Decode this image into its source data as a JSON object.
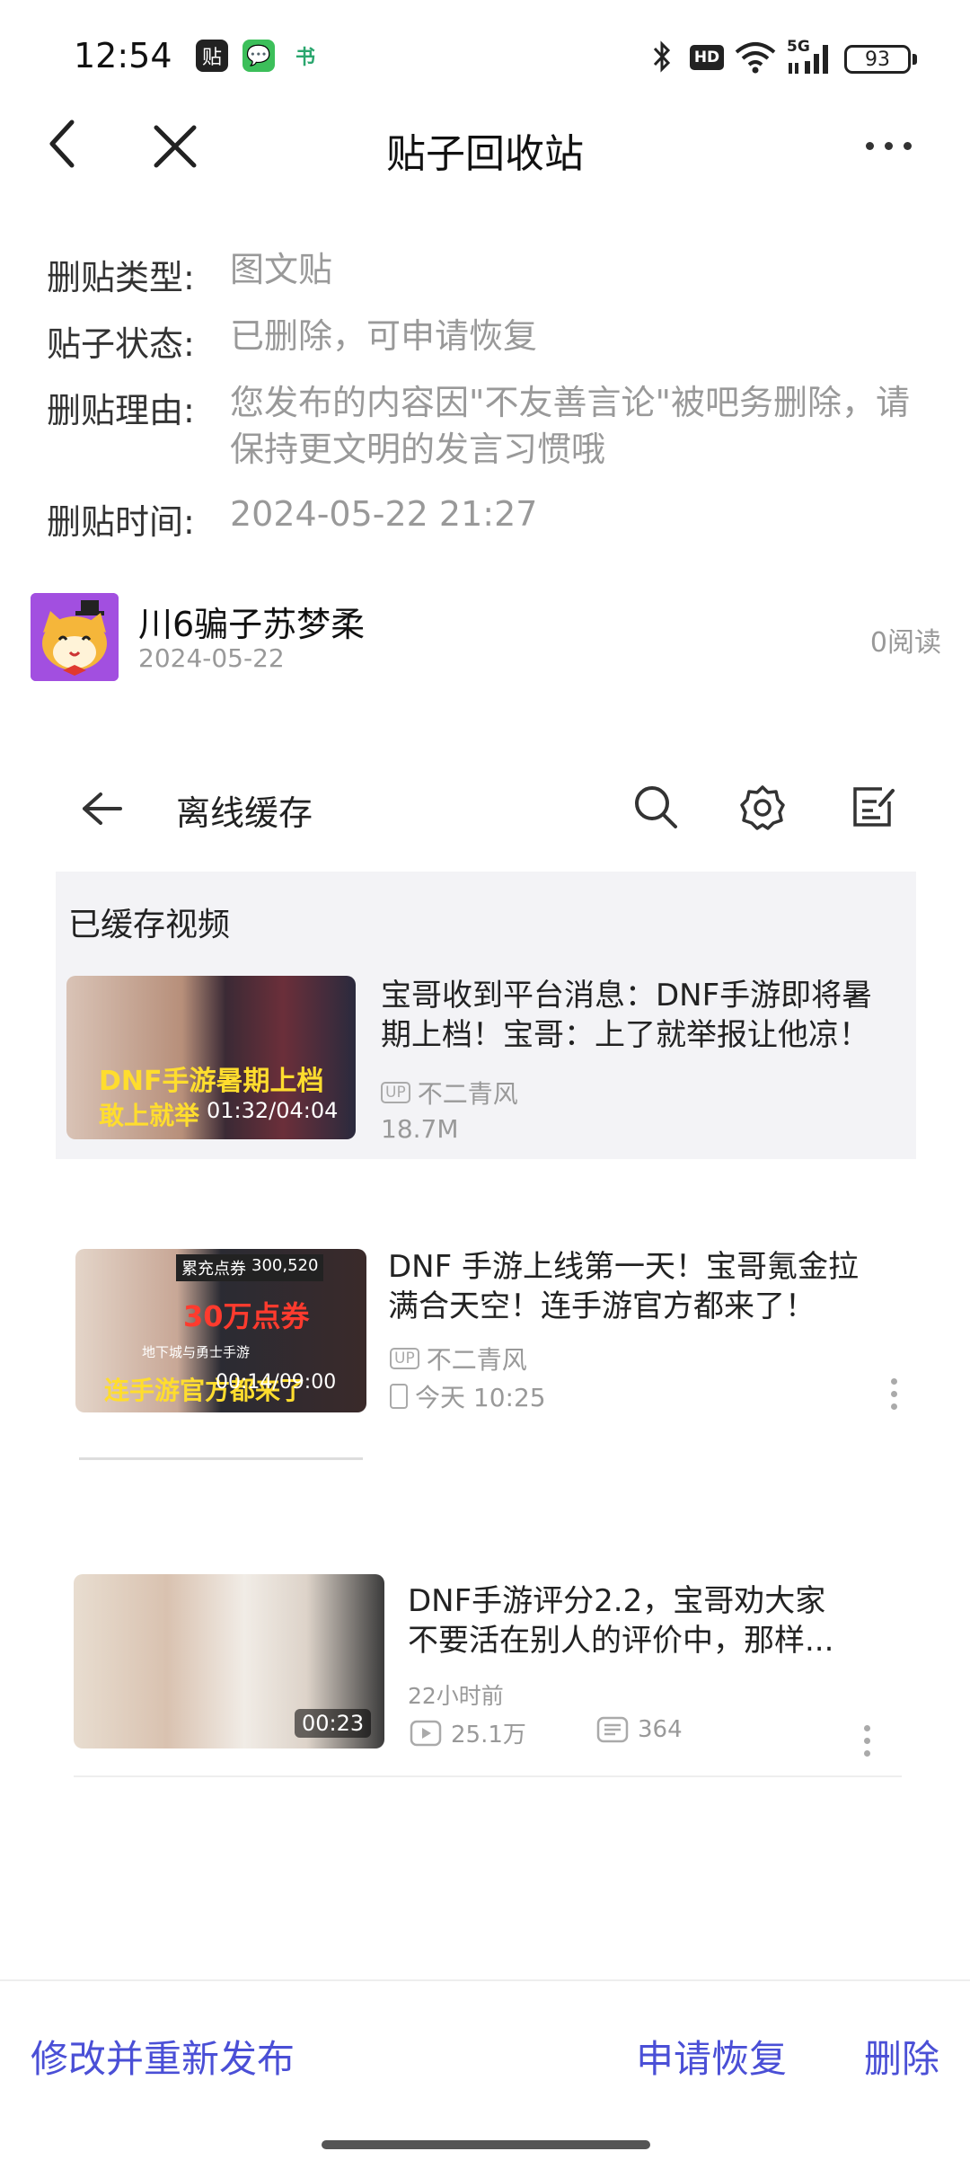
{
  "status_bar": {
    "time": "12:54",
    "app_icons": [
      "贴",
      "💬",
      "书"
    ],
    "network": "5G",
    "battery": "93"
  },
  "header": {
    "title": "贴子回收站"
  },
  "info": {
    "type_label": "删贴类型:",
    "type_value": "图文贴",
    "status_label": "贴子状态:",
    "status_value": "已删除，可申请恢复",
    "reason_label": "删贴理由:",
    "reason_line1": "您发布的内容因\"不友善言论\"被吧务删除，请",
    "reason_line2": "保持更文明的发言习惯哦",
    "time_label": "删贴时间:",
    "time_value": "2024-05-22 21:27"
  },
  "post": {
    "author": "川6骗子苏梦柔",
    "date": "2024-05-22",
    "reads": "0阅读"
  },
  "screenshot": {
    "page_title": "离线缓存",
    "section_title": "已缓存视频",
    "videos": [
      {
        "title_line1": "宝哥收到平台消息：DNF手游即将暑",
        "title_line2": "期上档！宝哥：上了就举报让他凉！",
        "uploader": "不二青风",
        "size": "18.7M",
        "thumb_text1": "DNF手游暑期上档",
        "thumb_text2": "敢上就举",
        "thumb_time": "01:32/04:04"
      },
      {
        "title_line1": "DNF 手游上线第一天！宝哥氪金拉",
        "title_line2": "满合天空！连手游官方都来了！",
        "uploader": "不二青风",
        "date": "今天 10:25",
        "thumb_badge": "累充点券",
        "thumb_points": "300,520",
        "thumb_text1": "30万点券",
        "thumb_text2": "连手游官方都来了",
        "thumb_game": "地下城与勇士手游",
        "thumb_time": "00:14/09:00"
      },
      {
        "title_line1": "DNF手游评分2.2，宝哥劝大家",
        "title_line2": "不要活在别人的评价中，那样...",
        "posted": "22小时前",
        "views": "25.1万",
        "comments": "364",
        "thumb_time": "00:23"
      }
    ],
    "badge_up": "UP"
  },
  "actions": {
    "edit_republish": "修改并重新发布",
    "restore": "申请恢复",
    "delete": "删除"
  },
  "colors": {
    "accent": "#4a4fd6",
    "muted_text": "#999999",
    "avatar_bg": "#a24fe0"
  }
}
